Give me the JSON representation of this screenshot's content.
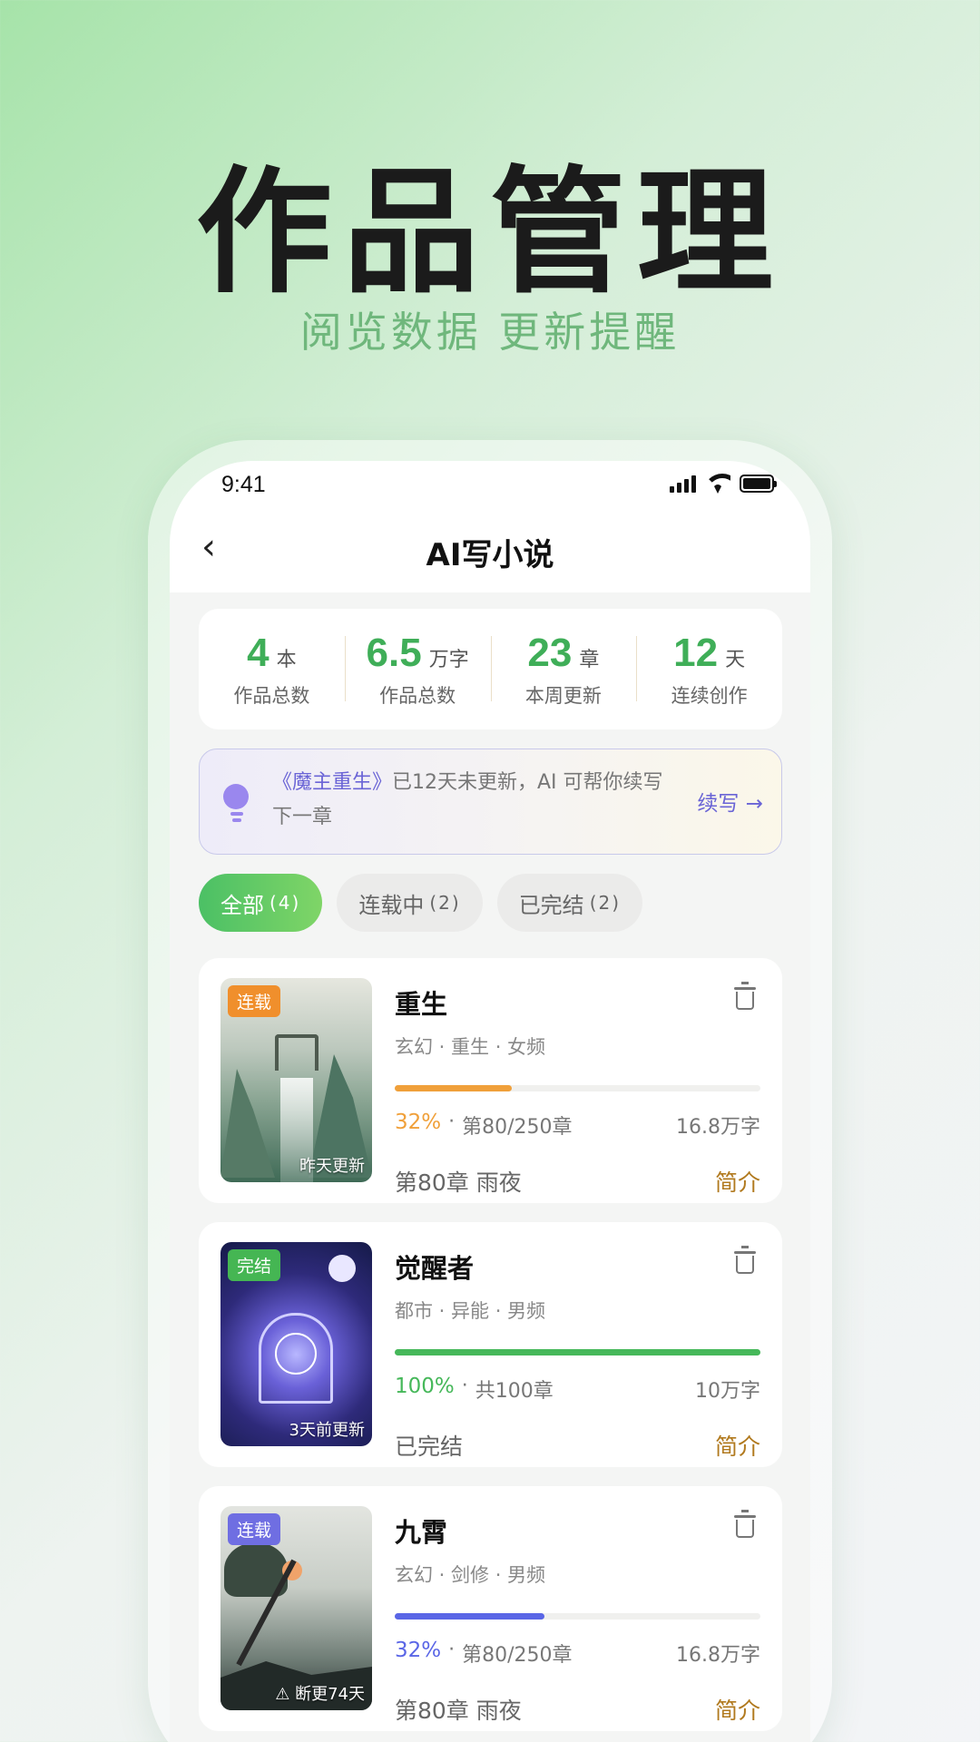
{
  "hero": {
    "title": "作品管理",
    "subtitle": "阅览数据 更新提醒"
  },
  "status_bar": {
    "time": "9:41"
  },
  "nav": {
    "back_icon": "‹",
    "title": "AI写小说"
  },
  "stats": [
    {
      "value": "4",
      "unit": "本",
      "label": "作品总数"
    },
    {
      "value": "6.5",
      "unit": "万字",
      "label": "作品总数"
    },
    {
      "value": "23",
      "unit": "章",
      "label": "本周更新"
    },
    {
      "value": "12",
      "unit": "天",
      "label": "连续创作"
    }
  ],
  "tip": {
    "book": "《魔主重生》",
    "message": "已12天未更新，AI 可帮你续写下一章",
    "action": "续写 →"
  },
  "tabs": [
    {
      "label": "全部",
      "count": "(4)"
    },
    {
      "label": "连载中",
      "count": "(2)"
    },
    {
      "label": "已完结",
      "count": "(2)"
    }
  ],
  "books": [
    {
      "badge": "连载",
      "badge_color": "#f08f2c",
      "update": "昨天更新",
      "title": "重生",
      "tags": "玄幻 · 重生 · 女频",
      "progress": 0.32,
      "progress_color": "#f0a03a",
      "percent": "32%",
      "chapters": "第80/250章",
      "words": "16.8万字",
      "latest": "第80章  雨夜",
      "intro": "简介"
    },
    {
      "badge": "完结",
      "badge_color": "#45b653",
      "update": "3天前更新",
      "title": "觉醒者",
      "tags": "都市 · 异能 · 男频",
      "progress": 1.0,
      "progress_color": "#46b85a",
      "percent": "100%",
      "chapters": "共100章",
      "words": "10万字",
      "latest": "已完结",
      "intro": "简介"
    },
    {
      "badge": "连载",
      "badge_color": "#6f6ee2",
      "update": "⚠ 断更74天",
      "title": "九霄",
      "tags": "玄幻 · 剑修 · 男频",
      "progress": 0.41,
      "progress_color": "#5a66e6",
      "percent": "32%",
      "chapters": "第80/250章",
      "words": "16.8万字",
      "latest": "第80章  雨夜",
      "intro": "简介"
    }
  ]
}
